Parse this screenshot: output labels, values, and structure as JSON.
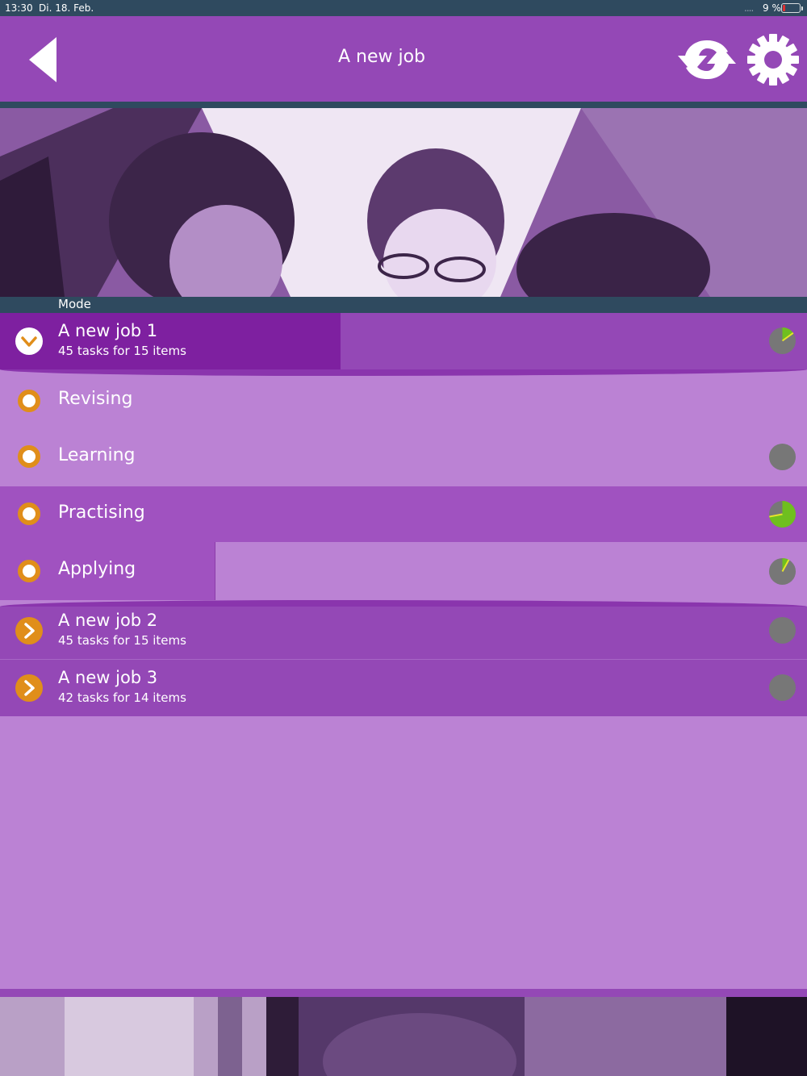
{
  "status_bar": {
    "time": "13:30",
    "date": "Di. 18. Feb.",
    "signal": "....",
    "battery": "9 %"
  },
  "header": {
    "title": "A new job"
  },
  "mode_label": "Mode",
  "jobs": [
    {
      "title": "A new job 1",
      "subtitle": "45 tasks for 15 items",
      "expanded": true,
      "progress": 0.15
    },
    {
      "title": "A new job 2",
      "subtitle": "45 tasks for 15 items",
      "expanded": false,
      "progress": 0
    },
    {
      "title": "A new job 3",
      "subtitle": "42 tasks for 14 items",
      "expanded": false,
      "progress": 0
    }
  ],
  "modes": [
    {
      "label": "Revising",
      "progress": null
    },
    {
      "label": "Learning",
      "progress": 0
    },
    {
      "label": "Practising",
      "progress": 0.72
    },
    {
      "label": "Applying",
      "progress": 0.08
    }
  ],
  "colors": {
    "header": "#9448b6",
    "accent": "#e08e1a",
    "progress_fill": "#6fbf1f",
    "progress_track": "#777777"
  },
  "icons": {
    "back": "triangle-left-icon",
    "sync": "sync-arrows-icon",
    "settings": "gear-icon",
    "expanded": "chevron-down-icon",
    "collapsed": "chevron-right-icon",
    "mode": "radio-dot-icon"
  }
}
